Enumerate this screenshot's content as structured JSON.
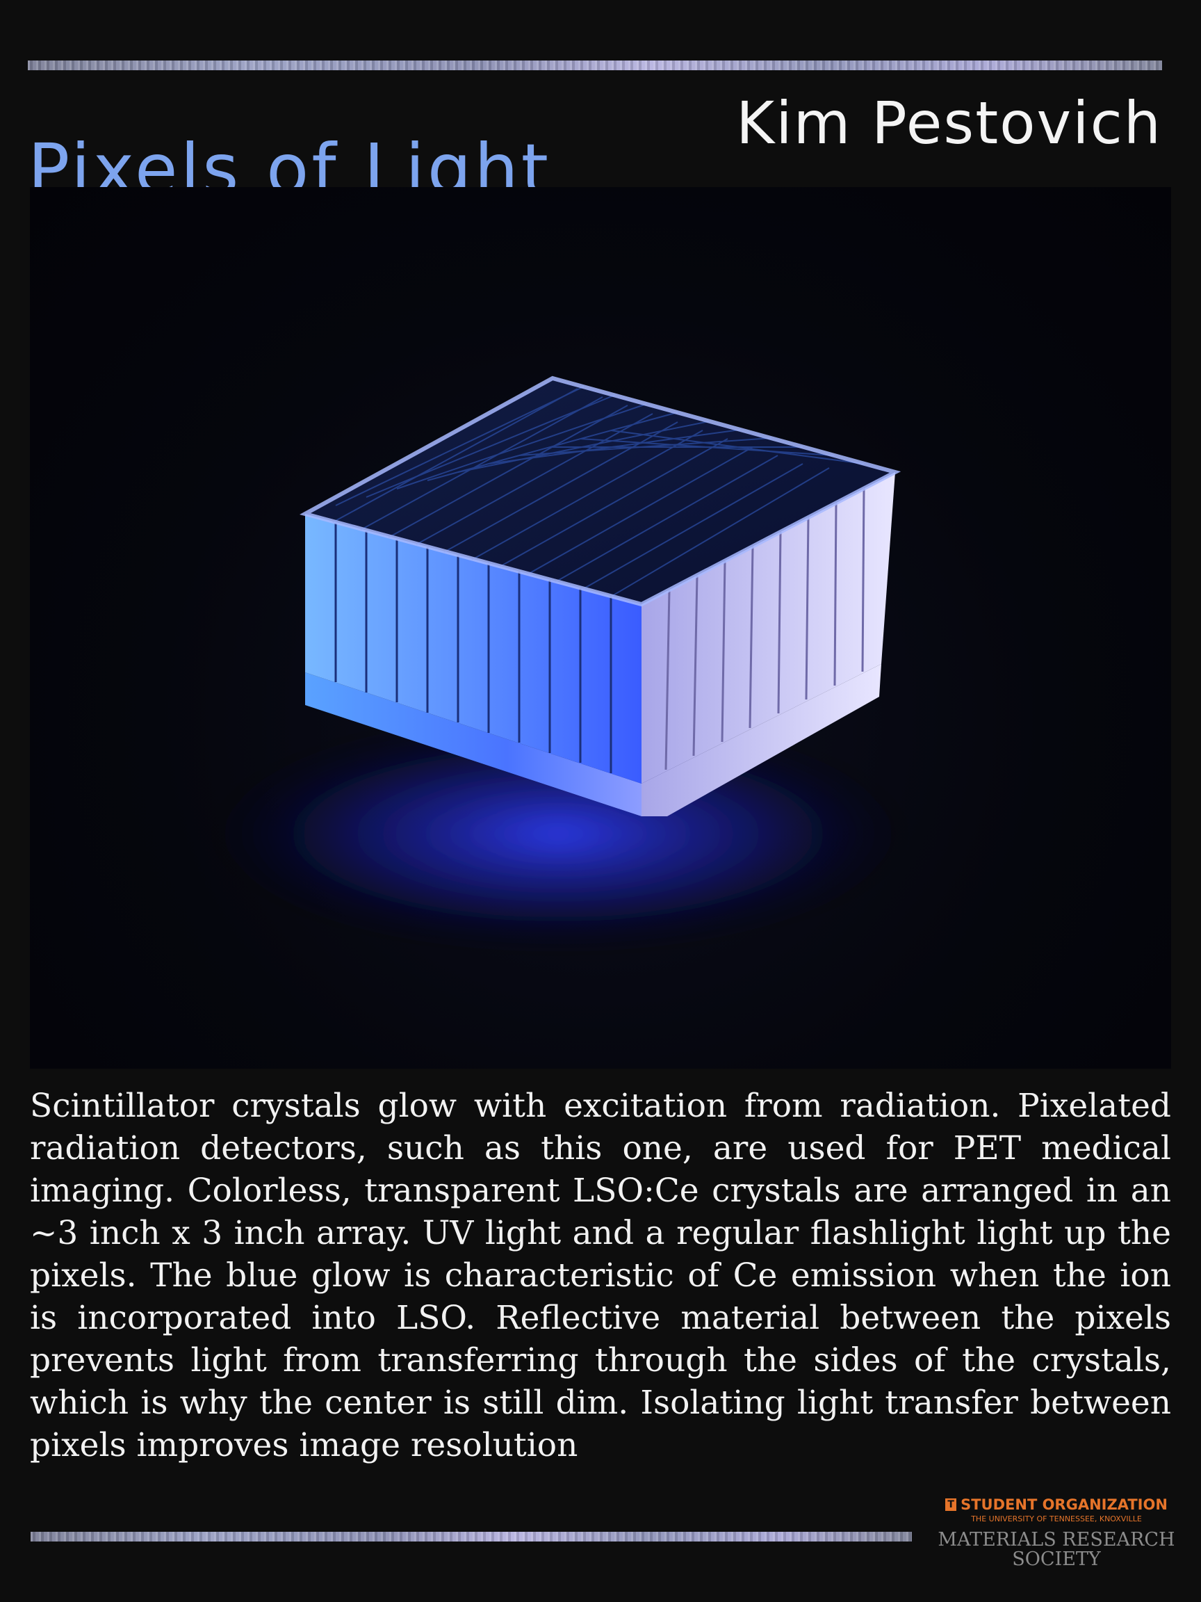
{
  "poster": {
    "title": "Pixels of Light",
    "author": "Kim Pestovich",
    "caption": "Scintillator crystals glow with excitation from radiation. Pixelated radiation detectors, such as this one, are used for PET medical imaging. Colorless, transparent LSO:Ce crystals are arranged in an ~3 inch x 3 inch array. UV light and a regular flashlight light up the pixels. The blue glow is characteristic of Ce emission when the ion is incorporated into LSO. Reflective material between the pixels prevents light from transferring through the sides of the crystals, which is why the center is still dim. Isolating light transfer between pixels improves image resolution"
  },
  "logo": {
    "mark": "T",
    "org": "STUDENT ORGANIZATION",
    "university": "THE UNIVERSITY OF TENNESSEE, KNOXVILLE",
    "name": "MATERIALS RESEARCH SOCIETY"
  },
  "colors": {
    "background": "#0d0d0d",
    "title": "#7da4ee",
    "author": "#f4f4f4",
    "glow": "#3b5bff",
    "logo_orange": "#e5742a"
  },
  "icons": {
    "logo_mark": "ut-power-t-icon"
  }
}
